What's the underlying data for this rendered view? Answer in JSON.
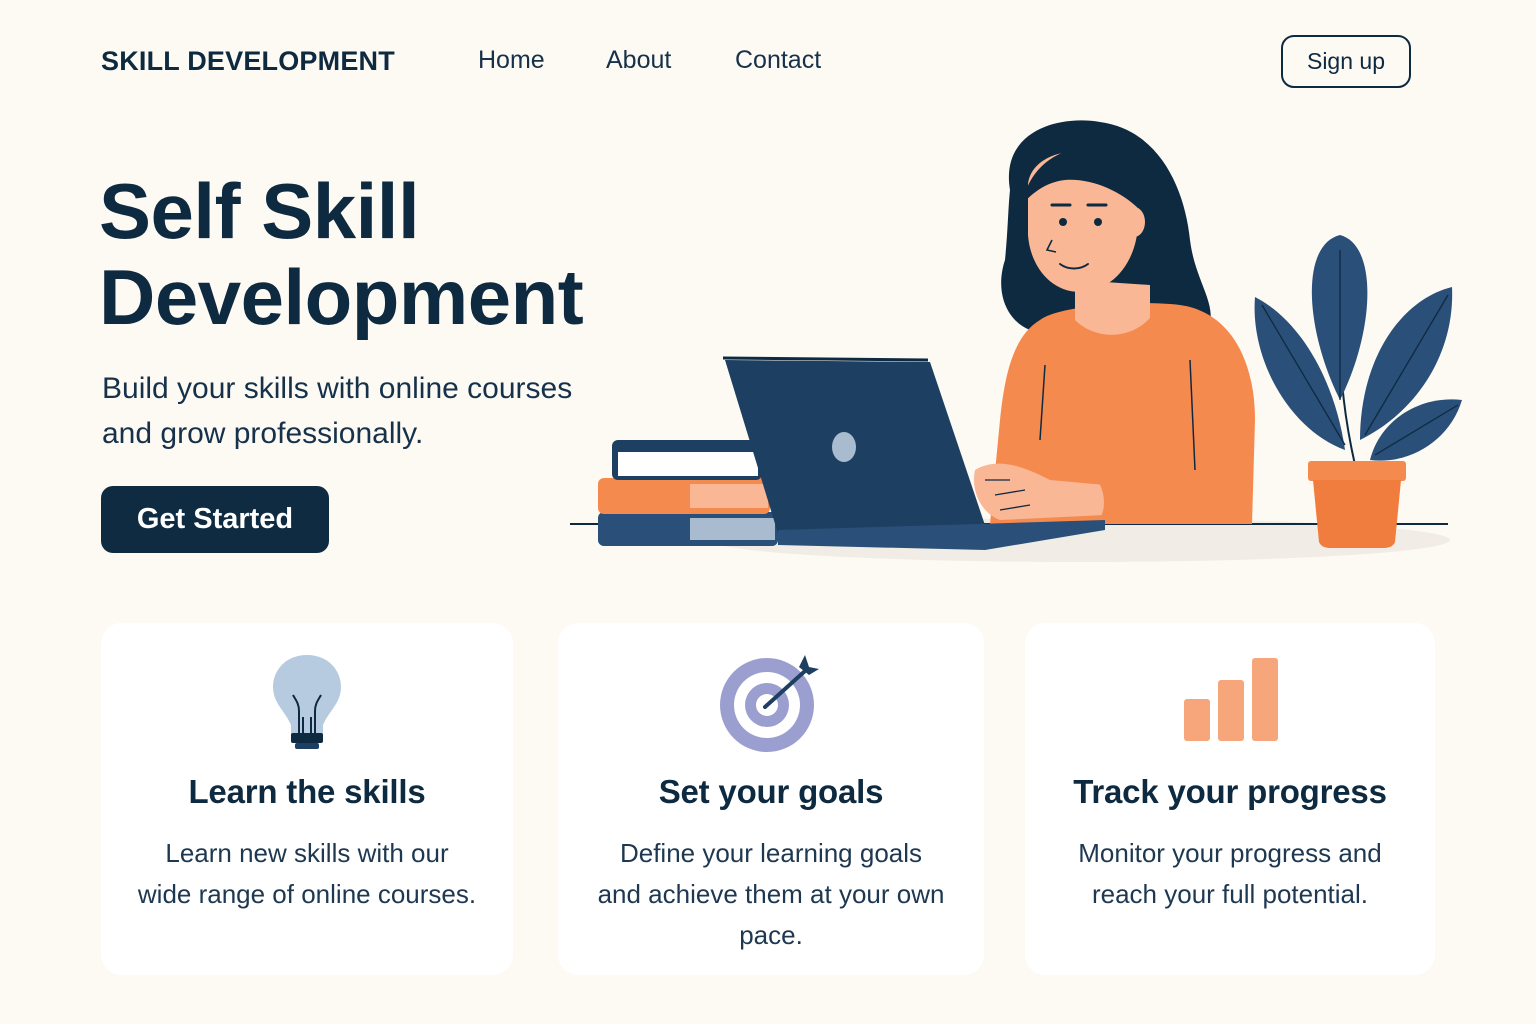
{
  "nav": {
    "brand": "SKILL DEVELOPMENT",
    "links": [
      "Home",
      "About",
      "Contact"
    ],
    "signup_label": "Sign up"
  },
  "hero": {
    "title_lines": [
      "Self Skill",
      "Development"
    ],
    "subtitle_lines": [
      "Build your skills with online courses",
      "and grow professionally."
    ],
    "cta_label": "Get Started"
  },
  "features": [
    {
      "icon": "lightbulb-icon",
      "title": "Learn the skills",
      "text_lines": [
        "Learn new skills with our",
        "wide range of online courses."
      ]
    },
    {
      "icon": "target-icon",
      "title": "Set your goals",
      "text_lines": [
        "Define your learning goals",
        "and achieve them at your own",
        "pace."
      ]
    },
    {
      "icon": "bar-chart-icon",
      "title": "Track your progress",
      "text_lines": [
        "Monitor your progress and",
        "reach your full potential."
      ]
    }
  ],
  "colors": {
    "background": "#fdf9f3",
    "navy": "#0e2a40",
    "orange": "#f58a4f",
    "blue": "#2a4f78",
    "bulb": "#b7cbe0",
    "target": "#9b9fd0",
    "bars": "#f7a57a"
  }
}
